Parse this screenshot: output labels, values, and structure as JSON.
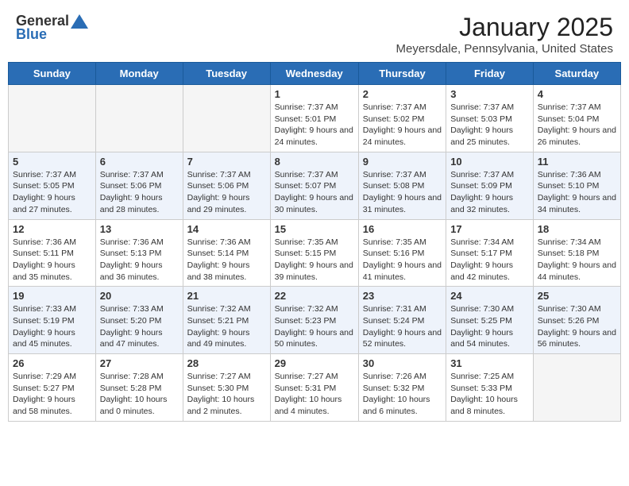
{
  "header": {
    "logo_general": "General",
    "logo_blue": "Blue",
    "month_year": "January 2025",
    "location": "Meyersdale, Pennsylvania, United States"
  },
  "days_of_week": [
    "Sunday",
    "Monday",
    "Tuesday",
    "Wednesday",
    "Thursday",
    "Friday",
    "Saturday"
  ],
  "weeks": [
    [
      {
        "day": "",
        "info": ""
      },
      {
        "day": "",
        "info": ""
      },
      {
        "day": "",
        "info": ""
      },
      {
        "day": "1",
        "info": "Sunrise: 7:37 AM\nSunset: 5:01 PM\nDaylight: 9 hours\nand 24 minutes."
      },
      {
        "day": "2",
        "info": "Sunrise: 7:37 AM\nSunset: 5:02 PM\nDaylight: 9 hours\nand 24 minutes."
      },
      {
        "day": "3",
        "info": "Sunrise: 7:37 AM\nSunset: 5:03 PM\nDaylight: 9 hours\nand 25 minutes."
      },
      {
        "day": "4",
        "info": "Sunrise: 7:37 AM\nSunset: 5:04 PM\nDaylight: 9 hours\nand 26 minutes."
      }
    ],
    [
      {
        "day": "5",
        "info": "Sunrise: 7:37 AM\nSunset: 5:05 PM\nDaylight: 9 hours\nand 27 minutes."
      },
      {
        "day": "6",
        "info": "Sunrise: 7:37 AM\nSunset: 5:06 PM\nDaylight: 9 hours\nand 28 minutes."
      },
      {
        "day": "7",
        "info": "Sunrise: 7:37 AM\nSunset: 5:06 PM\nDaylight: 9 hours\nand 29 minutes."
      },
      {
        "day": "8",
        "info": "Sunrise: 7:37 AM\nSunset: 5:07 PM\nDaylight: 9 hours\nand 30 minutes."
      },
      {
        "day": "9",
        "info": "Sunrise: 7:37 AM\nSunset: 5:08 PM\nDaylight: 9 hours\nand 31 minutes."
      },
      {
        "day": "10",
        "info": "Sunrise: 7:37 AM\nSunset: 5:09 PM\nDaylight: 9 hours\nand 32 minutes."
      },
      {
        "day": "11",
        "info": "Sunrise: 7:36 AM\nSunset: 5:10 PM\nDaylight: 9 hours\nand 34 minutes."
      }
    ],
    [
      {
        "day": "12",
        "info": "Sunrise: 7:36 AM\nSunset: 5:11 PM\nDaylight: 9 hours\nand 35 minutes."
      },
      {
        "day": "13",
        "info": "Sunrise: 7:36 AM\nSunset: 5:13 PM\nDaylight: 9 hours\nand 36 minutes."
      },
      {
        "day": "14",
        "info": "Sunrise: 7:36 AM\nSunset: 5:14 PM\nDaylight: 9 hours\nand 38 minutes."
      },
      {
        "day": "15",
        "info": "Sunrise: 7:35 AM\nSunset: 5:15 PM\nDaylight: 9 hours\nand 39 minutes."
      },
      {
        "day": "16",
        "info": "Sunrise: 7:35 AM\nSunset: 5:16 PM\nDaylight: 9 hours\nand 41 minutes."
      },
      {
        "day": "17",
        "info": "Sunrise: 7:34 AM\nSunset: 5:17 PM\nDaylight: 9 hours\nand 42 minutes."
      },
      {
        "day": "18",
        "info": "Sunrise: 7:34 AM\nSunset: 5:18 PM\nDaylight: 9 hours\nand 44 minutes."
      }
    ],
    [
      {
        "day": "19",
        "info": "Sunrise: 7:33 AM\nSunset: 5:19 PM\nDaylight: 9 hours\nand 45 minutes."
      },
      {
        "day": "20",
        "info": "Sunrise: 7:33 AM\nSunset: 5:20 PM\nDaylight: 9 hours\nand 47 minutes."
      },
      {
        "day": "21",
        "info": "Sunrise: 7:32 AM\nSunset: 5:21 PM\nDaylight: 9 hours\nand 49 minutes."
      },
      {
        "day": "22",
        "info": "Sunrise: 7:32 AM\nSunset: 5:23 PM\nDaylight: 9 hours\nand 50 minutes."
      },
      {
        "day": "23",
        "info": "Sunrise: 7:31 AM\nSunset: 5:24 PM\nDaylight: 9 hours\nand 52 minutes."
      },
      {
        "day": "24",
        "info": "Sunrise: 7:30 AM\nSunset: 5:25 PM\nDaylight: 9 hours\nand 54 minutes."
      },
      {
        "day": "25",
        "info": "Sunrise: 7:30 AM\nSunset: 5:26 PM\nDaylight: 9 hours\nand 56 minutes."
      }
    ],
    [
      {
        "day": "26",
        "info": "Sunrise: 7:29 AM\nSunset: 5:27 PM\nDaylight: 9 hours\nand 58 minutes."
      },
      {
        "day": "27",
        "info": "Sunrise: 7:28 AM\nSunset: 5:28 PM\nDaylight: 10 hours\nand 0 minutes."
      },
      {
        "day": "28",
        "info": "Sunrise: 7:27 AM\nSunset: 5:30 PM\nDaylight: 10 hours\nand 2 minutes."
      },
      {
        "day": "29",
        "info": "Sunrise: 7:27 AM\nSunset: 5:31 PM\nDaylight: 10 hours\nand 4 minutes."
      },
      {
        "day": "30",
        "info": "Sunrise: 7:26 AM\nSunset: 5:32 PM\nDaylight: 10 hours\nand 6 minutes."
      },
      {
        "day": "31",
        "info": "Sunrise: 7:25 AM\nSunset: 5:33 PM\nDaylight: 10 hours\nand 8 minutes."
      },
      {
        "day": "",
        "info": ""
      }
    ]
  ]
}
